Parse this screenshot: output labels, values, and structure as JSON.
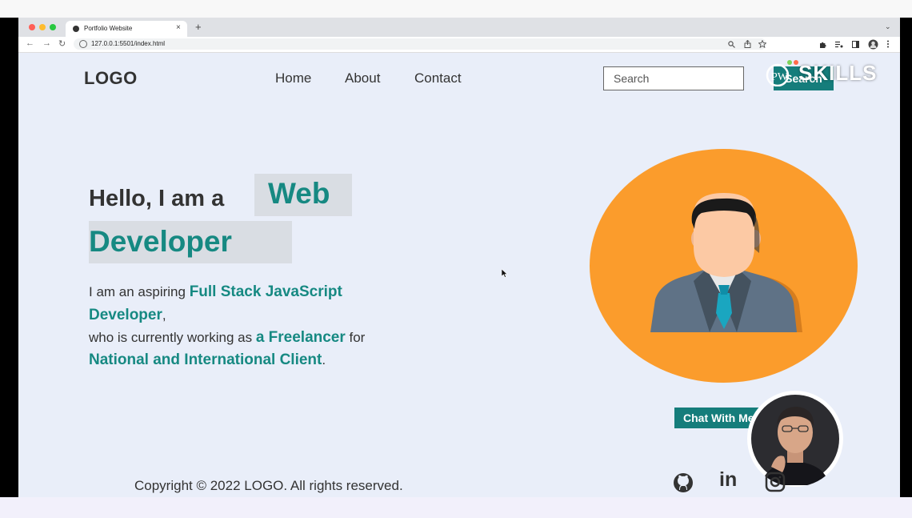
{
  "browser": {
    "tab_title": "Portfolio Website",
    "tab_close": "×",
    "new_tab": "+",
    "tab_dropdown": "⌄",
    "url": "127.0.0.1:5501/index.html",
    "nav_back": "←",
    "nav_forward": "→",
    "nav_reload": "↻"
  },
  "header": {
    "logo": "LOGO",
    "nav": [
      "Home",
      "About",
      "Contact"
    ],
    "search_placeholder": "Search",
    "search_button": "Search"
  },
  "watermark": {
    "brand": "SKILLS",
    "mark": "PW"
  },
  "hero": {
    "greeting": "Hello, I am a",
    "highlight_1": "Web",
    "highlight_2": "Developer"
  },
  "description": {
    "line1_prefix": "I am an aspiring ",
    "line1_highlight": "Full Stack JavaScript",
    "line2_highlight": "Developer",
    "line2_suffix": ",",
    "line3_prefix": "who is currently working as ",
    "line3_highlight": "a Freelancer",
    "line3_suffix": " for",
    "line4_highlight": "National and International Client",
    "line4_suffix": "."
  },
  "chat_button": "Chat With Me",
  "footer": {
    "copyright": "Copyright © 2022 LOGO. All rights reserved.",
    "social": [
      "github-icon",
      "linkedin-icon",
      "instagram-icon"
    ],
    "linkedin_label": "in"
  },
  "colors": {
    "accent": "#168982",
    "button": "#157d7b",
    "avatar_bg": "#fb9c2c",
    "page_bg": "#e9eef9"
  }
}
